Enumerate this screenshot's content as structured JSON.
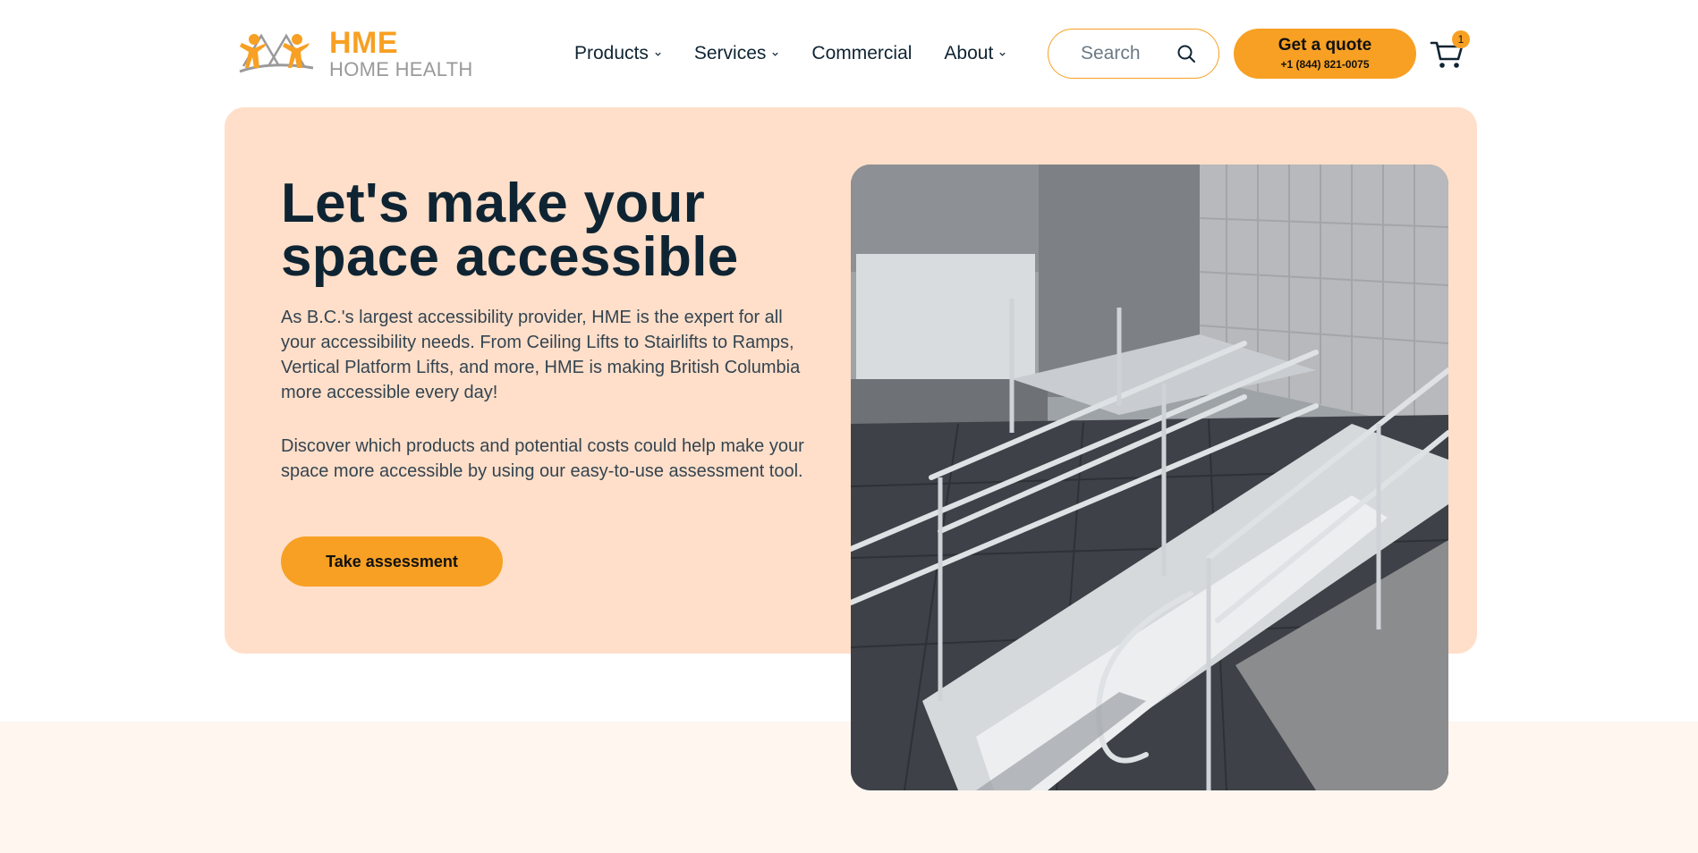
{
  "brand": {
    "name": "HME",
    "subtitle": "HOME HEALTH",
    "accent_color": "#f7a023",
    "hero_bg": "#ffdfc9"
  },
  "nav": {
    "items": [
      {
        "label": "Products",
        "has_dropdown": true
      },
      {
        "label": "Services",
        "has_dropdown": true
      },
      {
        "label": "Commercial",
        "has_dropdown": false
      },
      {
        "label": "About",
        "has_dropdown": true
      }
    ]
  },
  "search": {
    "placeholder": "Search",
    "icon": "search-icon"
  },
  "quote": {
    "label": "Get a quote",
    "phone": "+1 (844) 821-0075"
  },
  "cart": {
    "icon": "cart-icon",
    "count": "1"
  },
  "hero": {
    "title": "Let's make your space accessible",
    "paragraph1": "As B.C.'s largest accessibility provider, HME is the expert for all your accessibility needs. From Ceiling Lifts to Stairlifts to Ramps, Vertical Platform Lifts, and more, HME is making British Columbia more accessible every day!",
    "paragraph2": "Discover which products and potential costs could help make your space more accessible by using our easy-to-use assessment tool.",
    "cta_label": "Take assessment",
    "image": "aluminum-ramp-photo"
  }
}
